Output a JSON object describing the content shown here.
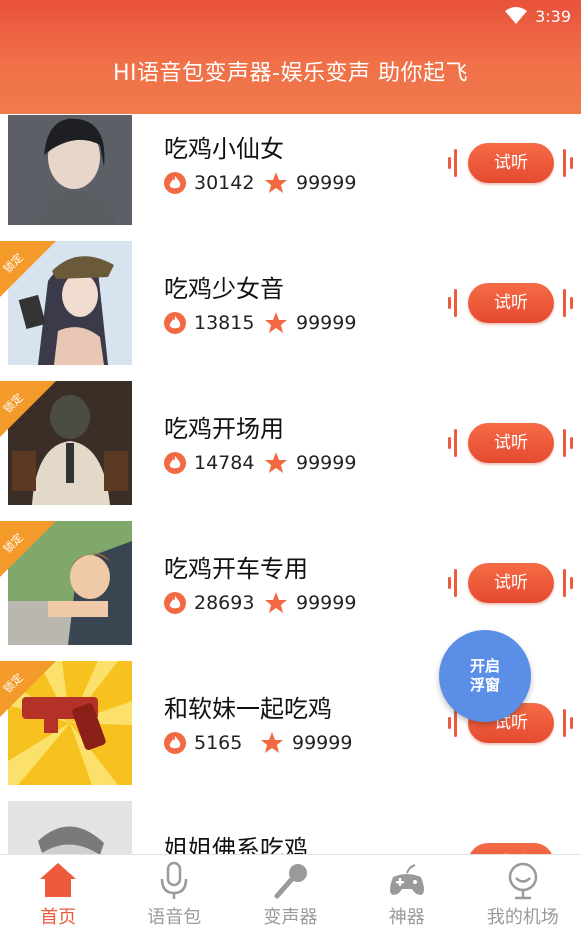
{
  "status": {
    "time": "3:39"
  },
  "header": {
    "title": "HI语音包变声器-娱乐变声 助你起飞"
  },
  "items": [
    {
      "name": "吃鸡小仙女",
      "plays": "30142",
      "likes": "99999",
      "listen": "试听",
      "locked": false
    },
    {
      "name": "吃鸡少女音",
      "plays": "13815",
      "likes": "99999",
      "listen": "试听",
      "locked": true,
      "lock_label": "锁定"
    },
    {
      "name": "吃鸡开场用",
      "plays": "14784",
      "likes": "99999",
      "listen": "试听",
      "locked": true,
      "lock_label": "锁定"
    },
    {
      "name": "吃鸡开车专用",
      "plays": "28693",
      "likes": "99999",
      "listen": "试听",
      "locked": true,
      "lock_label": "锁定"
    },
    {
      "name": "和软妹一起吃鸡",
      "plays": "5165",
      "likes": "99999",
      "listen": "试听",
      "locked": true,
      "lock_label": "锁定"
    },
    {
      "name": "姐姐佛系吃鸡",
      "plays": "",
      "likes": "",
      "listen": "试听",
      "locked": false
    }
  ],
  "float_button": {
    "line1": "开启",
    "line2": "浮窗"
  },
  "tabs": [
    {
      "label": "首页",
      "icon": "home-icon",
      "active": true
    },
    {
      "label": "语音包",
      "icon": "microphone-icon",
      "active": false
    },
    {
      "label": "变声器",
      "icon": "karaoke-mic-icon",
      "active": false
    },
    {
      "label": "神器",
      "icon": "gamepad-icon",
      "active": false
    },
    {
      "label": "我的机场",
      "icon": "profile-icon",
      "active": false
    }
  ],
  "colors": {
    "accent": "#ee5a3c",
    "header": "#f07048",
    "float": "#5b8ee6",
    "lock": "#f39a2a"
  }
}
